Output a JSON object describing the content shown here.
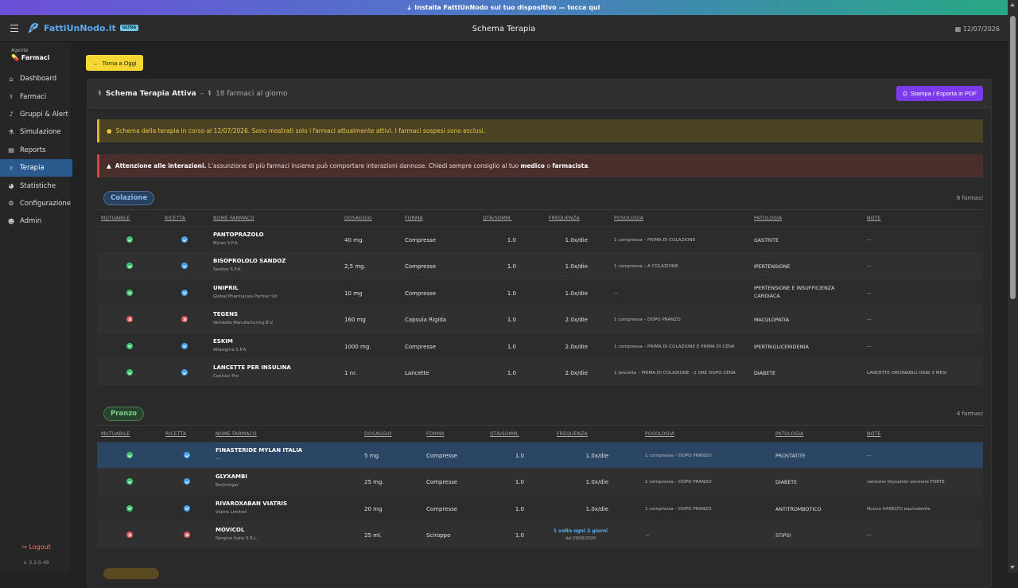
{
  "banner": {
    "text": "Installa FattiUnNodo sul tuo dispositivo — tocca qui"
  },
  "header": {
    "logo": "FattiUnNodo.it",
    "badge": "ULTRA",
    "title": "Schema Terapia",
    "date": "12/07/2026"
  },
  "sidebar": {
    "agent_label": "Agente",
    "agent_name": "Farmaci",
    "items": [
      {
        "label": "Dashboard",
        "icon": "home-icon",
        "glyph": "⌂"
      },
      {
        "label": "Farmaci",
        "icon": "pills-icon",
        "glyph": "⚕"
      },
      {
        "label": "Gruppi & Alert",
        "icon": "bell-icon",
        "glyph": "♪"
      },
      {
        "label": "Simulazione",
        "icon": "flask-icon",
        "glyph": "⚗"
      },
      {
        "label": "Reports",
        "icon": "chart-icon",
        "glyph": "▤"
      },
      {
        "label": "Terapia",
        "icon": "capsules-icon",
        "glyph": "⚕"
      },
      {
        "label": "Statistiche",
        "icon": "pie-icon",
        "glyph": "◕"
      },
      {
        "label": "Configurazione",
        "icon": "gear-icon",
        "glyph": "⚙"
      },
      {
        "label": "Admin",
        "icon": "users-icon",
        "glyph": "☻"
      }
    ],
    "active_index": 5,
    "logout": "Logout",
    "version": "v. 2.2.0.49"
  },
  "back_button": "Torna a Oggi",
  "card": {
    "title": "Schema Terapia Attiva",
    "subtitle": "18 farmaci al giorno",
    "print_button": "Stampa / Esporta in PDF"
  },
  "alerts": {
    "warning": "Schema della terapia in corso al 12/07/2026. Sono mostrati solo i farmaci attualmente attivi. I farmaci sospesi sono esclusi.",
    "danger_bold": "Attenzione alle interazioni.",
    "danger_text": " L'assunzione di più farmaci insieme può comportare interazioni dannose. Chiedi sempre consiglio al tuo ",
    "danger_b1": "medico",
    "danger_mid": " o ",
    "danger_b2": "farmacista",
    "danger_end": "."
  },
  "columns": [
    "MUTUABILE",
    "RICETTA",
    "NOME FARMACO",
    "DOSAGGIO",
    "FORMA",
    "QTÀ/SOMM.",
    "FREQUENZA",
    "POSOLOGIA",
    "PATOLOGIA",
    "NOTE"
  ],
  "sections": [
    {
      "label": "Colazione",
      "count": "6 farmaci",
      "rows": [
        {
          "mut": true,
          "rx": true,
          "name": "PANTOPRAZOLO",
          "maker": "Mylan S.P.A.",
          "dose": "40 mg.",
          "form": "Compresse",
          "qty": "1.0",
          "freq": "1.0x/die",
          "pos": "1 compressa – PRIMA DI COLAZIONE",
          "pat": "GASTRITE",
          "note": "—"
        },
        {
          "mut": true,
          "rx": true,
          "name": "BISOPROLOLO SANDOZ",
          "maker": "Sandoz S.P.A.",
          "dose": "2,5 mg.",
          "form": "Compresse",
          "qty": "1.0",
          "freq": "1.0x/die",
          "pos": "1 compressa – A COLAZIONE",
          "pat": "IPERTENSIONE",
          "note": "—"
        },
        {
          "mut": true,
          "rx": true,
          "name": "UNIPRIL",
          "maker": "Global Pharmacies Partner Srl",
          "dose": "10 mg",
          "form": "Compresse",
          "qty": "1.0",
          "freq": "1.0x/die",
          "pos": "—",
          "pat": "IPERTENSIONE E INSUFFICIENZA CARDIACA",
          "note": "—"
        },
        {
          "mut": false,
          "rx": false,
          "name": "TEGENS",
          "maker": "Vemedia Manufacturing B.V.",
          "dose": "160 mg",
          "form": "Capsula Rigida",
          "qty": "1.0",
          "freq": "2.0x/die",
          "pos": "1 compressa – DOPO PRANZO",
          "pat": "MACULOPATIA",
          "note": "—"
        },
        {
          "mut": true,
          "rx": true,
          "name": "ESKIM",
          "maker": "Alfasigma S.P.A.",
          "dose": "1000 mg.",
          "form": "Compresse",
          "qty": "1.0",
          "freq": "2.0x/die",
          "pos": "1 compressa – PRIMA DI COLAZIONE E PRIMA DI CENA",
          "pat": "IPERTRIGLICERIDEMIA",
          "note": "—"
        },
        {
          "mut": true,
          "rx": true,
          "name": "LANCETTE PER INSULINA",
          "maker": "Contour Pro",
          "dose": "1 nr.",
          "form": "Lancette",
          "qty": "1.0",
          "freq": "2.0x/die",
          "pos": "1 lancetta – PRIMA DI COLAZIONE - 2 ORE DOPO CENA",
          "pat": "DIABETE",
          "note": "LANCETTE ORDINABILI OGNI 3 MESI"
        }
      ]
    },
    {
      "label": "Pranzo",
      "count": "4 farmaci",
      "rows": [
        {
          "mut": true,
          "rx": true,
          "name": "FINASTERIDE MYLAN ITALIA",
          "maker": "—",
          "dose": "5 mg.",
          "form": "Compresse",
          "qty": "1.0",
          "freq": "1.0x/die",
          "pos": "1 compressa – DOPO PRANZO",
          "pat": "PROSTATITE",
          "note": "—"
        },
        {
          "mut": true,
          "rx": true,
          "name": "GLYXAMBI",
          "maker": "Bockringer",
          "dose": "25 mg.",
          "form": "Compresse",
          "qty": "1.0",
          "freq": "1.0x/die",
          "pos": "1 compressa – DOPO PRANZO",
          "pat": "DIABETE",
          "note": "versione Glyxambi versione FORTE"
        },
        {
          "mut": true,
          "rx": true,
          "name": "RIVAROXABAN VIATRIS",
          "maker": "Viatris Limited",
          "dose": "20 mg",
          "form": "Compresse",
          "qty": "1.0",
          "freq": "1.0x/die",
          "pos": "1 compressa – DOPO PRANZO",
          "pat": "ANTITROMBOTICO",
          "note": "Nuovo XARELTO equivalente"
        },
        {
          "mut": false,
          "rx": false,
          "name": "MOVICOL",
          "maker": "Norgine Italia S.R.L.",
          "dose": "25 ml.",
          "form": "Sciroppo",
          "qty": "1.0",
          "freq": "1 volta ogni 2 giorni",
          "freq_sub": "dal 29/06/2026",
          "pos": "—",
          "pat": "STIPSI",
          "note": "—"
        }
      ]
    }
  ]
}
